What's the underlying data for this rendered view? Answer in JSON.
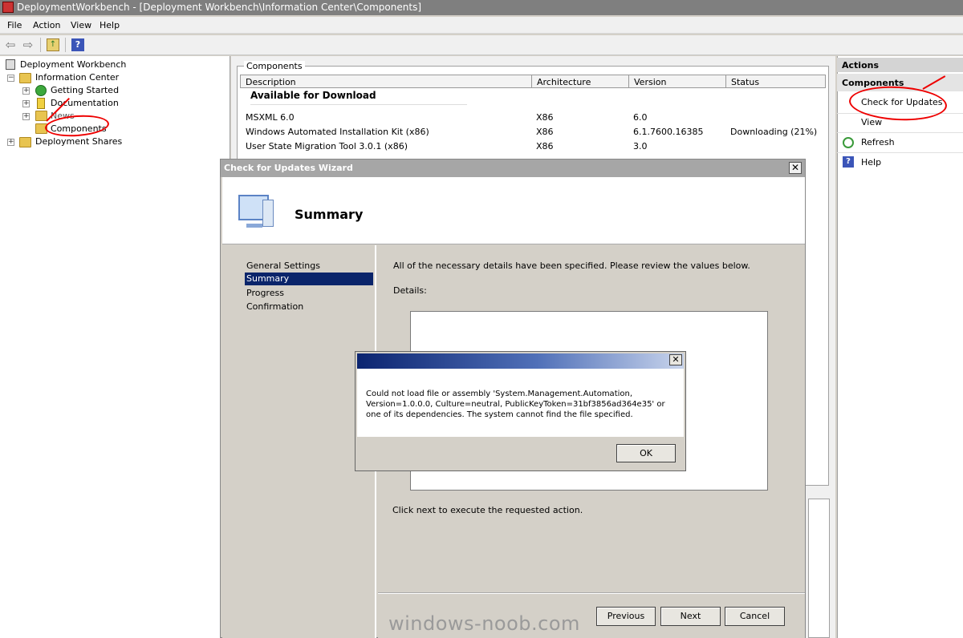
{
  "window": {
    "title": "DeploymentWorkbench - [Deployment Workbench\\Information Center\\Components]"
  },
  "menu": [
    "File",
    "Action",
    "View",
    "Help"
  ],
  "toolbar": {
    "help_glyph": "?"
  },
  "tree": {
    "root": "Deployment Workbench",
    "information_center": "Information Center",
    "getting_started": "Getting Started",
    "documentation": "Documentation",
    "news": "News",
    "components": "Components",
    "deployment_shares": "Deployment Shares",
    "expander_minus": "−",
    "expander_plus": "+"
  },
  "components": {
    "group_label": "Components",
    "columns": [
      "Description",
      "Architecture",
      "Version",
      "Status"
    ],
    "section_title": "Available for Download",
    "rows": [
      {
        "description": "MSXML 6.0",
        "architecture": "X86",
        "version": "6.0",
        "status": ""
      },
      {
        "description": "Windows Automated Installation Kit (x86)",
        "architecture": "X86",
        "version": "6.1.7600.16385",
        "status": "Downloading (21%)"
      },
      {
        "description": "User State Migration Tool 3.0.1 (x86)",
        "architecture": "X86",
        "version": "3.0",
        "status": ""
      }
    ]
  },
  "actions": {
    "header": "Actions",
    "section": "Components",
    "items": [
      "Check for Updates",
      "View",
      "Refresh",
      "Help"
    ]
  },
  "wizard": {
    "title": "Check for Updates Wizard",
    "heading": "Summary",
    "close_glyph": "✕",
    "steps": [
      "General Settings",
      "Summary",
      "Progress",
      "Confirmation"
    ],
    "intro": "All of the necessary details have been specified.  Please review the values below.",
    "details_label": "Details:",
    "footer_text": "Click next to execute the requested action.",
    "buttons": {
      "previous": "Previous",
      "next": "Next",
      "cancel": "Cancel"
    }
  },
  "error_dialog": {
    "message": "Could not load file or assembly 'System.Management.Automation,\nVersion=1.0.0.0, Culture=neutral, PublicKeyToken=31bf3856ad364e35' or\none of its dependencies. The system cannot find the file specified.",
    "ok": "OK",
    "close_glyph": "✕"
  },
  "watermark": "windows-noob.com",
  "colors": {
    "annotation_red": "#e00000",
    "selection_blue": "#0a246a"
  }
}
